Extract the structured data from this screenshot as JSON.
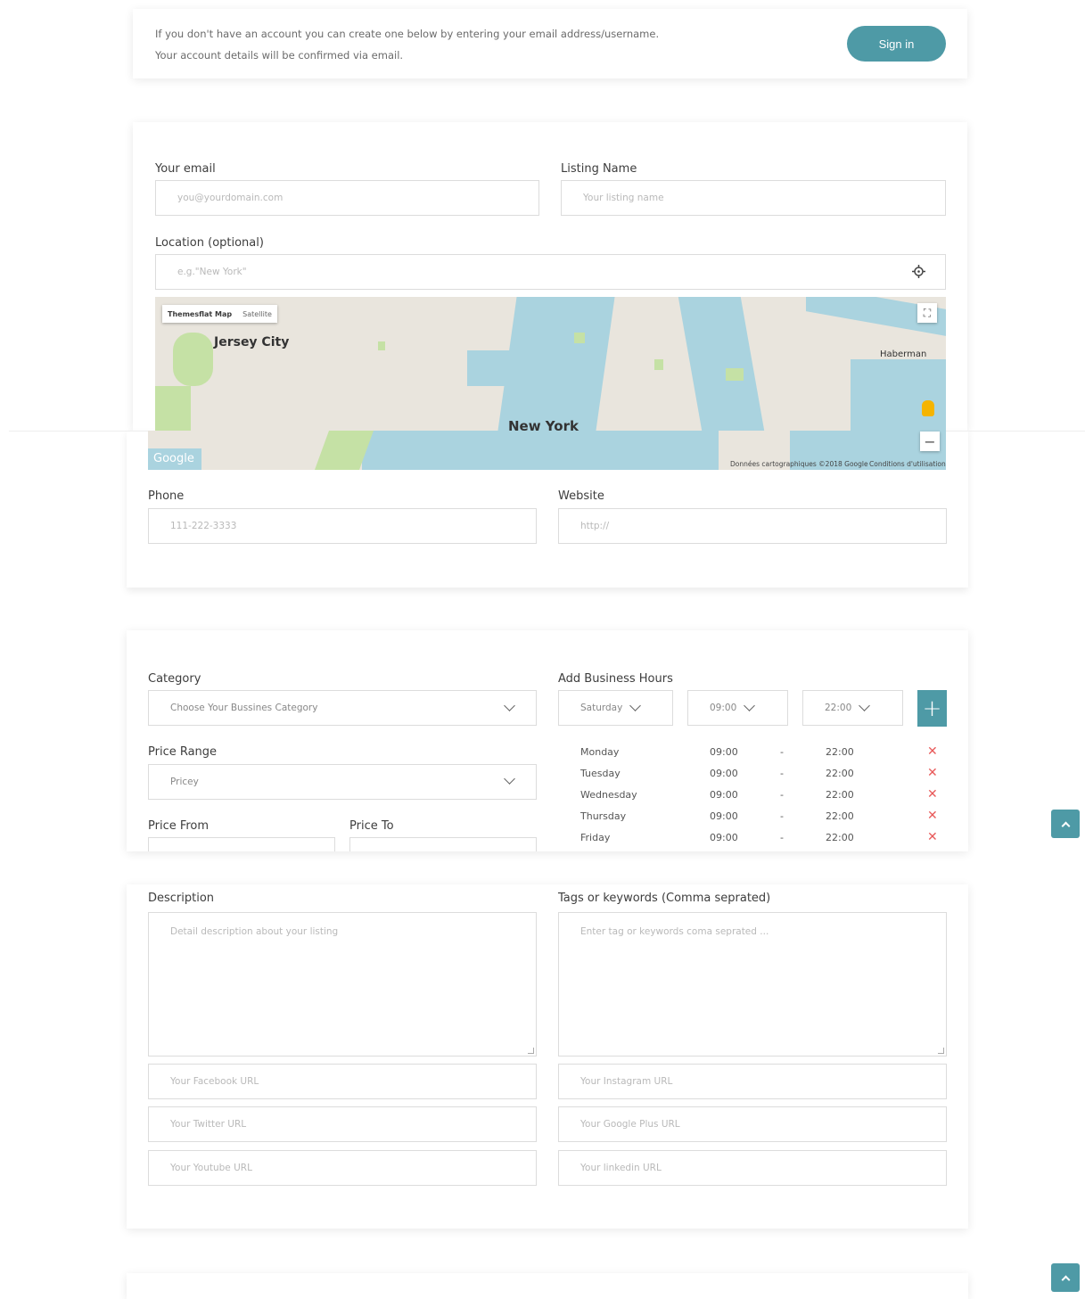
{
  "signup_notice": {
    "line1": "If you don't have an account you can create one below by entering your email address/username.",
    "line2": "Your account details will be confirmed via email.",
    "signin_label": "Sign in"
  },
  "listing": {
    "email_label": "Your email",
    "email_placeholder": "you@yourdomain.com",
    "name_label": "Listing Name",
    "name_placeholder": "Your listing name",
    "location_label": "Location (optional)",
    "location_placeholder": "e.g.\"New York\"",
    "phone_label": "Phone",
    "phone_placeholder": "111-222-3333",
    "website_label": "Website",
    "website_placeholder": "http://"
  },
  "map": {
    "type_map": "Themesflat Map",
    "type_satellite": "Satellite",
    "city1": "Jersey City",
    "city2": "New York",
    "city3": "Haberman",
    "google": "Google",
    "attribution": "Données cartographiques ©2018 Google",
    "terms": "Conditions d'utilisation"
  },
  "details": {
    "category_label": "Category",
    "category_value": "Choose Your Bussines Category",
    "price_range_label": "Price Range",
    "price_range_value": "Pricey",
    "price_from_label": "Price From",
    "price_to_label": "Price To",
    "hours_label": "Add Business Hours",
    "day_select": "Saturday",
    "open_select": "09:00",
    "close_select": "22:00",
    "hours": [
      {
        "day": "Monday",
        "open": "09:00",
        "sep": "-",
        "close": "22:00"
      },
      {
        "day": "Tuesday",
        "open": "09:00",
        "sep": "-",
        "close": "22:00"
      },
      {
        "day": "Wednesday",
        "open": "09:00",
        "sep": "-",
        "close": "22:00"
      },
      {
        "day": "Thursday",
        "open": "09:00",
        "sep": "-",
        "close": "22:00"
      },
      {
        "day": "Friday",
        "open": "09:00",
        "sep": "-",
        "close": "22:00"
      }
    ]
  },
  "extra": {
    "description_label": "Description",
    "description_placeholder": "Detail description about your listing",
    "tags_label": "Tags or keywords (Comma seprated)",
    "tags_placeholder": "Enter tag or keywords coma seprated ...",
    "facebook": "Your Facebook URL",
    "instagram": "Your Instagram URL",
    "twitter": "Your Twitter URL",
    "googleplus": "Your Google Plus URL",
    "youtube": "Your Youtube URL",
    "linkedin": "Your linkedin URL"
  },
  "colors": {
    "accent": "#4e9aa6",
    "remove": "#e85a5a"
  }
}
